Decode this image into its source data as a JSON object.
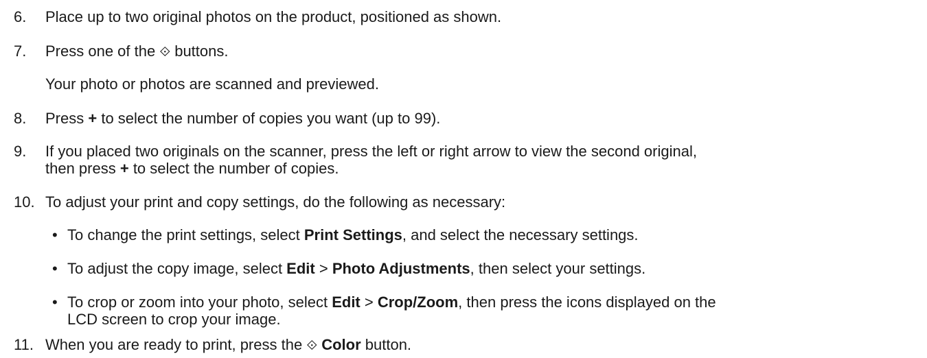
{
  "steps": [
    {
      "number": "6.",
      "text": "Place up to two original photos on the product, positioned as shown."
    },
    {
      "number": "7.",
      "text_before": "Press one of the ",
      "icon": "start-diamond-icon",
      "text_after": " buttons."
    },
    {
      "sub_text": "Your photo or photos are scanned and previewed."
    },
    {
      "number": "8.",
      "text_before": "Press ",
      "bold": "+",
      "text_after": " to select the number of copies you want (up to 99)."
    },
    {
      "number": "9.",
      "line1": "If you placed two originals on the scanner, press the left or right arrow to view the second original,",
      "line2_before": "then press ",
      "line2_bold": "+",
      "line2_after": " to select the number of copies."
    },
    {
      "number": "10.",
      "text": "To adjust your print and copy settings, do the following as necessary:"
    },
    {
      "number": "11.",
      "text_before": "When you are ready to print, press the ",
      "icon": "start-diamond-icon",
      "bold": "Color",
      "text_after": " button."
    }
  ],
  "bullets": [
    {
      "text_before": "To change the print settings, select ",
      "bold": "Print Settings",
      "text_after": ", and select the necessary settings."
    },
    {
      "text_before": "To adjust the copy image, select ",
      "bold1": "Edit",
      "sep": " > ",
      "bold2": "Photo Adjustments",
      "text_after": ", then select your settings."
    },
    {
      "text_before": "To crop or zoom into your photo, select ",
      "bold1": "Edit",
      "sep": " > ",
      "bold2": "Crop/Zoom",
      "text_after": ", then press the icons displayed on the",
      "line2": "LCD screen to crop your image."
    }
  ],
  "bullet_char": "•",
  "icon_glyph": "⟐"
}
